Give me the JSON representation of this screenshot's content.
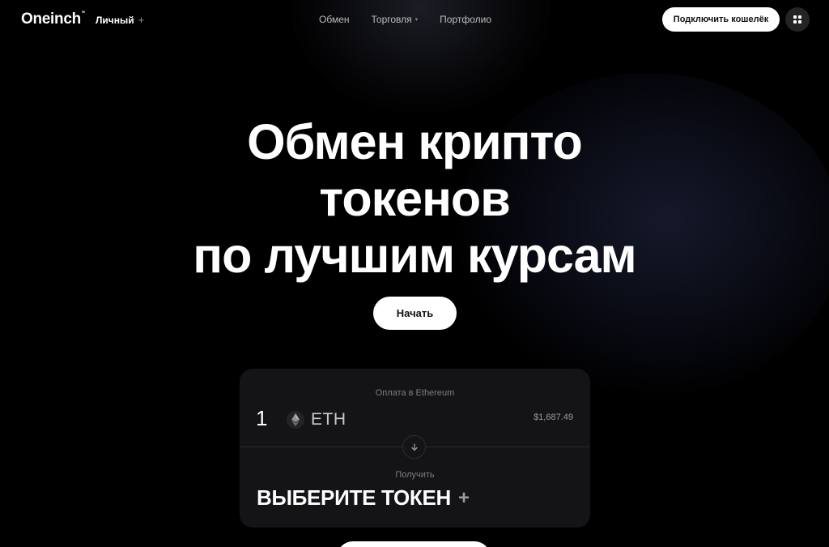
{
  "header": {
    "logo": "Oneinch",
    "logo_mark": "\"",
    "account_type": "Личный",
    "account_plus": "+",
    "nav": [
      {
        "label": "Обмен"
      },
      {
        "label": "Торговля",
        "caret": "▾"
      },
      {
        "label": "Портфолио"
      }
    ],
    "connect_wallet": "Подключить кошелёк",
    "apps_icon": "grid-icon"
  },
  "hero": {
    "line1": "Обмен крипто",
    "line2": "токенов",
    "line3": "по лучшим курсам",
    "start_button": "Начать"
  },
  "swap": {
    "pay_label": "Оплата в Ethereum",
    "pay_amount": "1",
    "pay_token": "ETH",
    "pay_token_icon": "ethereum-icon",
    "pay_usd": "$1,687.49",
    "swap_icon": "arrow-down-icon",
    "receive_label": "Получить",
    "select_token": "ВЫБЕРИТЕ ТОКЕН",
    "select_plus": "+"
  },
  "colors": {
    "background": "#000000",
    "card": "#141416",
    "button": "#ffffff"
  }
}
